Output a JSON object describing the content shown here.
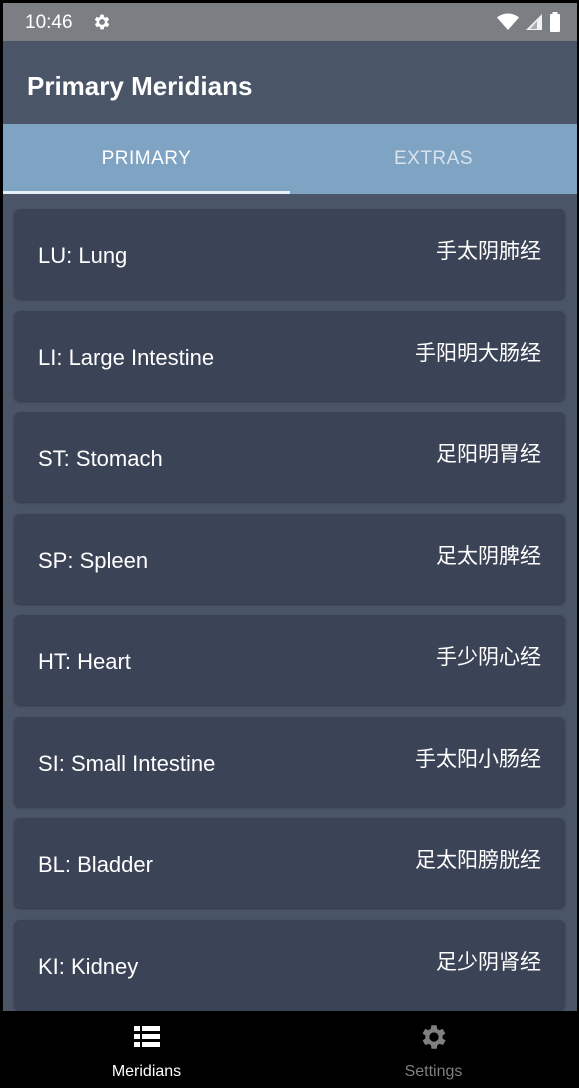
{
  "status_bar": {
    "time": "10:46"
  },
  "app_bar": {
    "title": "Primary Meridians"
  },
  "tabs": [
    {
      "label": "PRIMARY",
      "selected": true
    },
    {
      "label": "EXTRAS",
      "selected": false
    }
  ],
  "meridians": [
    {
      "label": "LU: Lung",
      "chinese": "手太阴肺经"
    },
    {
      "label": "LI: Large Intestine",
      "chinese": "手阳明大肠经"
    },
    {
      "label": "ST: Stomach",
      "chinese": "足阳明胃经"
    },
    {
      "label": "SP: Spleen",
      "chinese": "足太阴脾经"
    },
    {
      "label": "HT: Heart",
      "chinese": "手少阴心经"
    },
    {
      "label": "SI: Small Intestine",
      "chinese": "手太阳小肠经"
    },
    {
      "label": "BL: Bladder",
      "chinese": "足太阳膀胱经"
    },
    {
      "label": "KI: Kidney",
      "chinese": "足少阴肾经"
    }
  ],
  "bottom_nav": [
    {
      "label": "Meridians",
      "icon": "list-icon",
      "active": true
    },
    {
      "label": "Settings",
      "icon": "gear-icon",
      "active": false
    }
  ],
  "colors": {
    "background": "#4a5568",
    "card": "#3b4356",
    "tab_bar": "#7fa3c3",
    "status_bar": "#7b7f84",
    "nav_bar": "#000000"
  }
}
